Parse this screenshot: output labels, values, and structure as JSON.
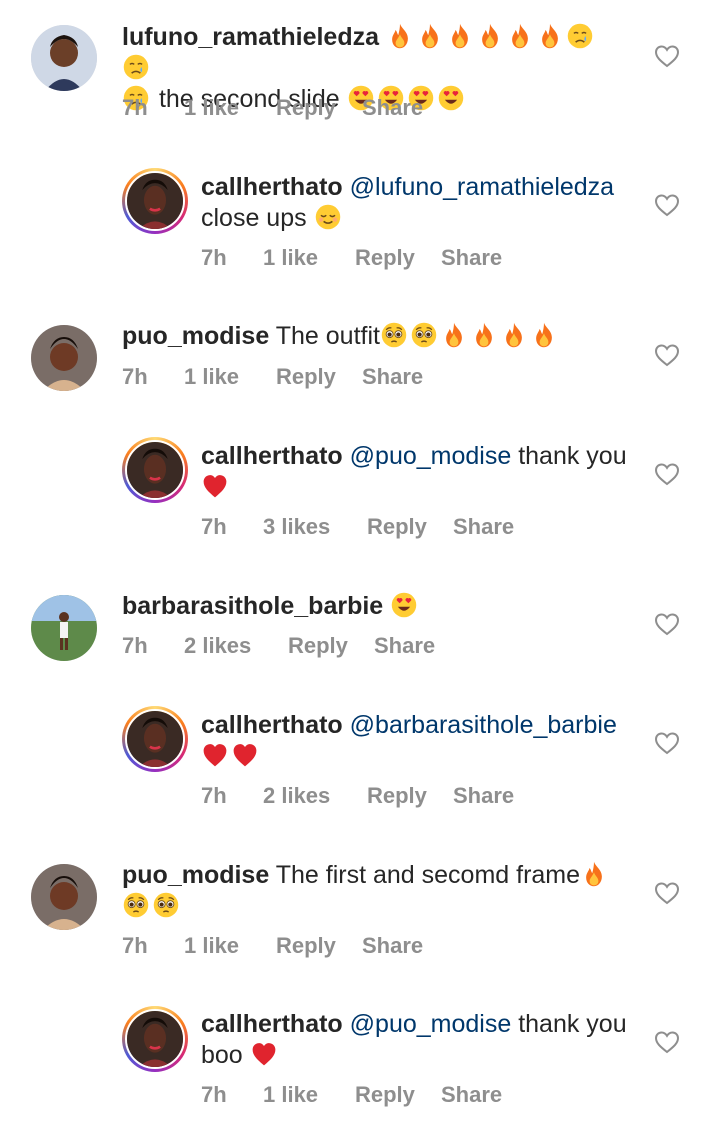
{
  "colors": {
    "username": "#262626",
    "mention": "#00376b",
    "meta": "#8e8e8e",
    "heart": "#e0242e",
    "fire": "#f7711a"
  },
  "comments": [
    {
      "username": "lufuno_ramathieledza",
      "body_line2": "the second slide",
      "time": "7h",
      "likes": "1 like",
      "reply": "Reply",
      "share": "Share"
    },
    {
      "username": "callherthato",
      "mention": "@lufuno_ramathieledza",
      "body_line2": "close ups",
      "time": "7h",
      "likes": "1 like",
      "reply": "Reply",
      "share": "Share"
    },
    {
      "username": "puo_modise",
      "body": "The outfit",
      "time": "7h",
      "likes": "1 like",
      "reply": "Reply",
      "share": "Share"
    },
    {
      "username": "callherthato",
      "mention": "@puo_modise",
      "body": "thank you",
      "time": "7h",
      "likes": "3 likes",
      "reply": "Reply",
      "share": "Share"
    },
    {
      "username": "barbarasithole_barbie",
      "time": "7h",
      "likes": "2 likes",
      "reply": "Reply",
      "share": "Share"
    },
    {
      "username": "callherthato",
      "mention": "@barbarasithole_barbie",
      "time": "7h",
      "likes": "2 likes",
      "reply": "Reply",
      "share": "Share"
    },
    {
      "username": "puo_modise",
      "body": "The first and secomd frame",
      "time": "7h",
      "likes": "1 like",
      "reply": "Reply",
      "share": "Share"
    },
    {
      "username": "callherthato",
      "mention": "@puo_modise",
      "body": "thank you",
      "body_line2": "boo",
      "time": "7h",
      "likes": "1 like",
      "reply": "Reply",
      "share": "Share"
    }
  ],
  "icons": {
    "like": "heart-outline-icon",
    "fire": "fire-emoji",
    "crying": "crying-face-emoji",
    "heart_eyes": "heart-eyes-emoji",
    "relieved": "relieved-face-emoji",
    "pleading": "pleading-face-emoji",
    "red_heart": "red-heart-emoji"
  }
}
